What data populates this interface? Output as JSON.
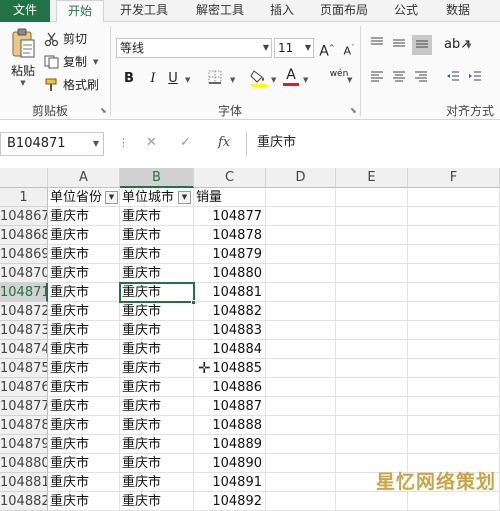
{
  "tabs": [
    "文件",
    "开始",
    "开发工具",
    "解密工具",
    "插入",
    "页面布局",
    "公式",
    "数据"
  ],
  "clipboard": {
    "paste": "粘贴",
    "cut": "剪切",
    "copy": "复制",
    "format_painter": "格式刷",
    "group_label": "剪贴板"
  },
  "font": {
    "name": "等线",
    "size": "11",
    "grow": "A",
    "shrink": "A",
    "bold": "B",
    "italic": "I",
    "underline": "U",
    "font_color_glyph": "A",
    "phonetic_glyph": "wén",
    "group_label": "字体"
  },
  "alignment": {
    "group_label": "对齐方式"
  },
  "formula_bar": {
    "name_box": "B104871",
    "cancel": "✕",
    "enter": "✓",
    "fx": "fx",
    "content": "重庆市"
  },
  "columns": [
    "A",
    "B",
    "C",
    "D",
    "E",
    "F"
  ],
  "header_row": {
    "row_number": "1",
    "a": "单位省份",
    "b": "单位城市",
    "c": "销量"
  },
  "rows": [
    {
      "num": "104867",
      "a": "重庆市",
      "b": "重庆市",
      "c": "104877"
    },
    {
      "num": "104868",
      "a": "重庆市",
      "b": "重庆市",
      "c": "104878"
    },
    {
      "num": "104869",
      "a": "重庆市",
      "b": "重庆市",
      "c": "104879"
    },
    {
      "num": "104870",
      "a": "重庆市",
      "b": "重庆市",
      "c": "104880"
    },
    {
      "num": "104871",
      "a": "重庆市",
      "b": "重庆市",
      "c": "104881"
    },
    {
      "num": "104872",
      "a": "重庆市",
      "b": "重庆市",
      "c": "104882"
    },
    {
      "num": "104873",
      "a": "重庆市",
      "b": "重庆市",
      "c": "104883"
    },
    {
      "num": "104874",
      "a": "重庆市",
      "b": "重庆市",
      "c": "104884"
    },
    {
      "num": "104875",
      "a": "重庆市",
      "b": "重庆市",
      "c": "104885"
    },
    {
      "num": "104876",
      "a": "重庆市",
      "b": "重庆市",
      "c": "104886"
    },
    {
      "num": "104877",
      "a": "重庆市",
      "b": "重庆市",
      "c": "104887"
    },
    {
      "num": "104878",
      "a": "重庆市",
      "b": "重庆市",
      "c": "104888"
    },
    {
      "num": "104879",
      "a": "重庆市",
      "b": "重庆市",
      "c": "104889"
    },
    {
      "num": "104880",
      "a": "重庆市",
      "b": "重庆市",
      "c": "104890"
    },
    {
      "num": "104881",
      "a": "重庆市",
      "b": "重庆市",
      "c": "104891"
    },
    {
      "num": "104882",
      "a": "重庆市",
      "b": "重庆市",
      "c": "104892"
    }
  ],
  "watermark": "星忆网络策划",
  "colors": {
    "accent": "#217346",
    "selected_header": "#d2d2d2"
  }
}
